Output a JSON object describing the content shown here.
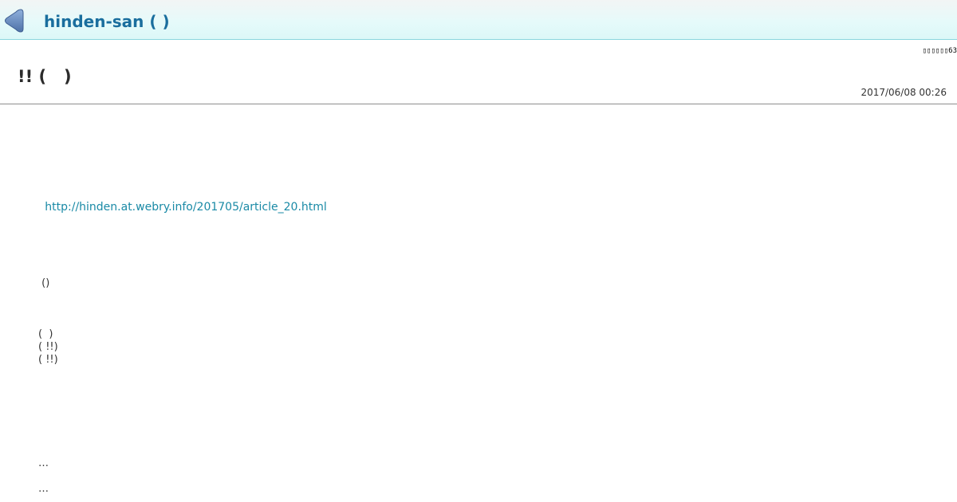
{
  "header": {
    "blog_title": "hinden-san ( )",
    "back_icon": "back-arrow-icon"
  },
  "counter": "▯▯▯▯▯▯63",
  "article": {
    "title": "!! (   )",
    "date": "2017/06/08 00:26",
    "link": "http://hinden.at.webry.info/201705/article_20.html",
    "lines": [
      " ()",
      "(  )",
      "( !!)",
      "( !!)",
      "…",
      "…"
    ]
  },
  "colors": {
    "header_bg": "#e6fafa",
    "header_border": "#8ad6de",
    "title_color": "#1a6e9e",
    "link_color": "#1a8aa6",
    "back_icon_fill": "#6d8fbf"
  }
}
